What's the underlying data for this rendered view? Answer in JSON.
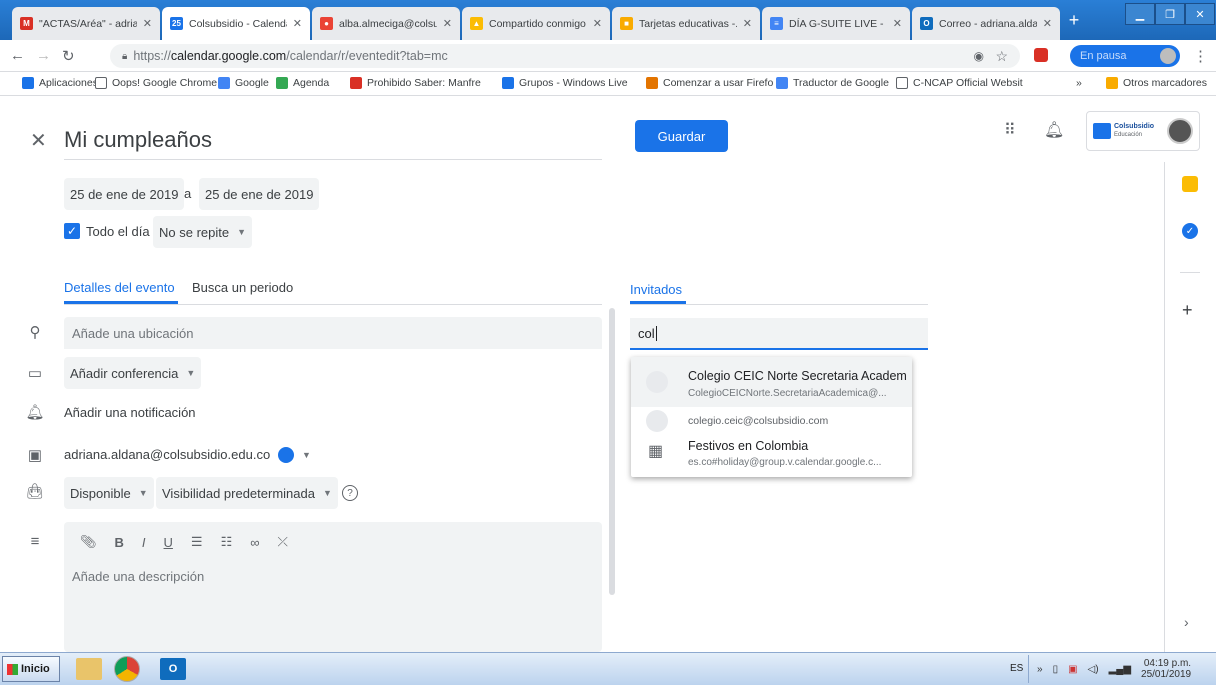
{
  "browser": {
    "tabs": [
      {
        "label": "\"ACTAS/Aréa\" - adria...",
        "color": "#d93025",
        "glyph": "M"
      },
      {
        "label": "Colsubsidio - Calenda...",
        "color": "#1a73e8",
        "glyph": "25"
      },
      {
        "label": "alba.almeciga@colsub...",
        "color": "#ea4335",
        "glyph": "●"
      },
      {
        "label": "Compartido conmigo -...",
        "color": "#fbbc04",
        "glyph": "▲"
      },
      {
        "label": "Tarjetas educativas -...",
        "color": "#f9ab00",
        "glyph": "■"
      },
      {
        "label": "DÍA G-SUITE LIVE - D...",
        "color": "#4285f4",
        "glyph": "≡"
      },
      {
        "label": "Correo - adriana.alda...",
        "color": "#0f6cbd",
        "glyph": "O"
      }
    ],
    "new_tab": "+",
    "url_scheme": "https://",
    "url_host": "calendar.google.com",
    "url_path": "/calendar/r/eventedit?tab=mc",
    "paused_label": "En pausa",
    "bookmarks": [
      {
        "label": "Aplicaciones",
        "color": "#1a73e8"
      },
      {
        "label": "Oops! Google Chrome c",
        "color": "#ffffff"
      },
      {
        "label": "Google",
        "color": "#4285f4"
      },
      {
        "label": "Agenda",
        "color": "#34a853"
      },
      {
        "label": "Prohibido Saber: Manfre",
        "color": "#d93025"
      },
      {
        "label": "Grupos - Windows Live",
        "color": "#1a73e8"
      },
      {
        "label": "Comenzar a usar Firefo",
        "color": "#e37400"
      },
      {
        "label": "Traductor de Google",
        "color": "#4285f4"
      },
      {
        "label": "C-NCAP Official Websit",
        "color": "#ffffff"
      }
    ],
    "other_bookmarks": "Otros marcadores",
    "more_bookmarks": "»"
  },
  "event": {
    "title": "Mi cumpleaños",
    "save_label": "Guardar",
    "start_date": "25 de ene de 2019",
    "date_separator": "a",
    "end_date": "25 de ene de 2019",
    "all_day_label": "Todo el día",
    "repeat_label": "No se repite",
    "tabs": {
      "details": "Detalles del evento",
      "find_time": "Busca un periodo"
    },
    "location_placeholder": "Añade una ubicación",
    "conference_label": "Añadir conferencia",
    "notification_label": "Añadir una notificación",
    "calendar_owner": "adriana.aldana@colsubsidio.edu.co",
    "availability_label": "Disponible",
    "visibility_label": "Visibilidad predeterminada",
    "description_placeholder": "Añade una descripción",
    "calendar_color": "#1a73e8"
  },
  "guests": {
    "heading": "Invitados",
    "input_value": "col",
    "suggestions": [
      {
        "name": "Colegio CEIC Norte Secretaria Academ",
        "email": "ColegioCEICNorte.SecretariaAcademica@..."
      },
      {
        "name": "",
        "email": "colegio.ceic@colsubsidio.com"
      },
      {
        "name": "Festivos en Colombia",
        "email": "es.co#holiday@group.v.calendar.google.c..."
      }
    ]
  },
  "header": {
    "logo_text": "Colsubsidio",
    "logo_sub": "Educación"
  },
  "taskbar": {
    "start_label": "Inicio",
    "language": "ES",
    "time": "04:19 p.m.",
    "date": "25/01/2019"
  }
}
